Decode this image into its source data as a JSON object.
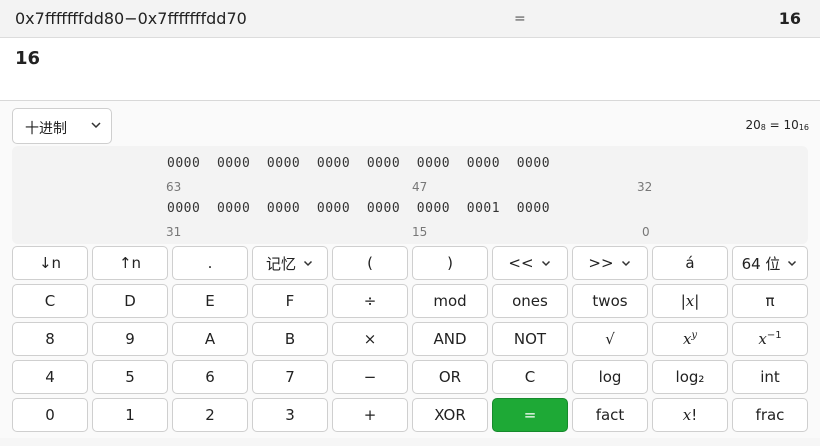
{
  "history": {
    "expression": "0x7fffffffdd80−0x7fffffffdd70",
    "equals": "=",
    "result": "16"
  },
  "display": {
    "value": "16"
  },
  "base": {
    "selected": "十进制",
    "conversion": "20",
    "conversion_mid": " = 10",
    "sub8": "8",
    "sub16": "16"
  },
  "bits": {
    "row_high": "0000  0000  0000  0000  0000  0000  0000  0000",
    "row_low": "0000  0000  0000  0000  0000  0000  0001  0000",
    "idx_high": [
      "63",
      "47",
      "32"
    ],
    "idx_low": [
      "31",
      "15",
      "0"
    ]
  },
  "keypad": {
    "rows": [
      [
        "↓n",
        "↑n",
        ".",
        "记忆",
        "(",
        ")",
        "<<",
        ">>",
        "á",
        "64 位"
      ],
      [
        "C",
        "D",
        "E",
        "F",
        "÷",
        "mod",
        "ones",
        "twos",
        "|x|",
        "π"
      ],
      [
        "8",
        "9",
        "A",
        "B",
        "×",
        "AND",
        "NOT",
        "√",
        "x^y",
        "x⁻¹"
      ],
      [
        "4",
        "5",
        "6",
        "7",
        "−",
        "OR",
        "C",
        "log",
        "log₂",
        "int"
      ],
      [
        "0",
        "1",
        "2",
        "3",
        "+",
        "XOR",
        "=",
        "fact",
        "x!",
        "frac"
      ]
    ]
  },
  "colors": {
    "accent": "#1ea936"
  }
}
